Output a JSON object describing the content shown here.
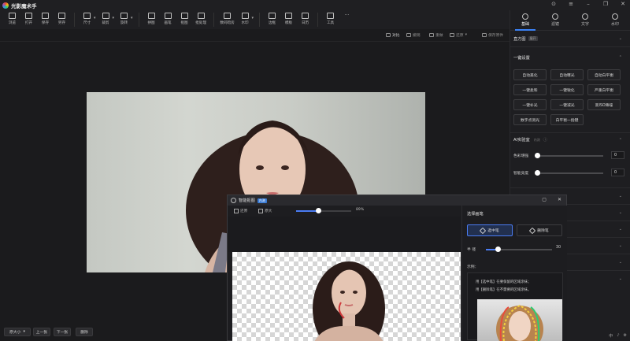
{
  "app": {
    "title": "光影魔术手"
  },
  "toolbar": {
    "items": [
      {
        "label": "浏览",
        "icon": "browse-icon"
      },
      {
        "label": "打开",
        "icon": "open-folder-icon"
      },
      {
        "label": "保存",
        "icon": "save-icon"
      },
      {
        "label": "另存",
        "icon": "save-as-icon"
      },
      {
        "label": "尺寸",
        "icon": "resize-icon"
      },
      {
        "label": "裁剪",
        "icon": "crop-icon"
      },
      {
        "label": "旋转",
        "icon": "rotate-icon"
      },
      {
        "label": "拼图",
        "icon": "collage-icon"
      },
      {
        "label": "画笔",
        "icon": "brush-icon"
      },
      {
        "label": "抠图",
        "icon": "cutout-icon"
      },
      {
        "label": "批处理",
        "icon": "batch-icon"
      },
      {
        "label": "数码暗房",
        "icon": "darkroom-icon"
      },
      {
        "label": "水印",
        "icon": "watermark-icon"
      },
      {
        "label": "边框",
        "icon": "border-icon"
      },
      {
        "label": "模板",
        "icon": "template-icon"
      },
      {
        "label": "日历",
        "icon": "calendar-icon"
      },
      {
        "label": "工具",
        "icon": "tools-icon"
      },
      {
        "label": "···",
        "icon": "more-icon"
      }
    ]
  },
  "subbar": {
    "compare": "对比",
    "undo": "撤销",
    "redo": "重做",
    "restore": "还原",
    "save_original": "保存原件"
  },
  "bottombar": {
    "zoom": "原大小",
    "prev": "上一张",
    "next": "下一张",
    "delete": "删除"
  },
  "right_panel": {
    "tabs": [
      {
        "label": "基础",
        "icon": "basic-icon"
      },
      {
        "label": "滤镜",
        "icon": "filter-icon"
      },
      {
        "label": "文字",
        "icon": "text-icon"
      },
      {
        "label": "水印",
        "icon": "watermark-icon"
      }
    ],
    "histogram": {
      "label": "直方图",
      "badge": "展开"
    },
    "one_click": {
      "title": "一键设置",
      "buttons": [
        "自动美化",
        "自动曝光",
        "自动白平衡",
        "一键柔和",
        "一键锐化",
        "严重白平衡",
        "一键补光",
        "一键减光",
        "高ISO降噪",
        "数字点测光",
        "白平衡一指键"
      ]
    },
    "ai_lab": {
      "title": "AI实验室",
      "badge": "内测",
      "sliders": [
        {
          "label": "色彩增强",
          "value": "0",
          "level": 0
        },
        {
          "label": "智能亮度",
          "value": "0",
          "level": 0
        }
      ]
    },
    "collapsed_sections": 7,
    "footer": {
      "a": "中",
      "b": "♪",
      "c": "⚙"
    }
  },
  "dialog": {
    "title": "智能抠图",
    "tag": "内测",
    "tools": {
      "restore": "还原",
      "original_size": "原大",
      "zoom_label": "89%",
      "zoom_level": 0.4
    },
    "brush": {
      "title": "选择画笔",
      "select_brush": "选中笔",
      "remove_brush": "删除笔",
      "size_label": "半    径",
      "size_value": "30",
      "size_level": 0.18,
      "example_title": "示例：",
      "hint_1": "用【选中笔】在要保留的区域涂抹；",
      "hint_2": "用【删除笔】在不需要的区域涂抹。"
    }
  },
  "colors": {
    "accent": "#3b82f6",
    "dialog_slider": "#4a7cf3"
  }
}
